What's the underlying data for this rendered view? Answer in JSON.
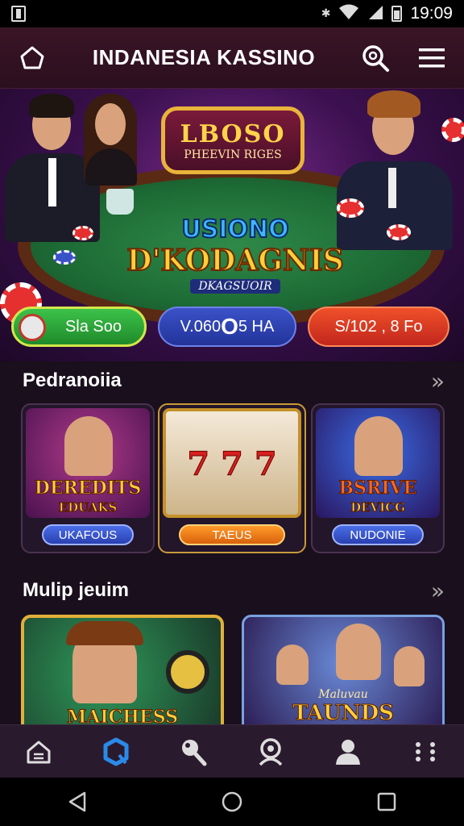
{
  "status_bar": {
    "time": "19:09"
  },
  "app_bar": {
    "title": "INDANESIA KASSINO"
  },
  "hero": {
    "badge_title": "LBOSO",
    "badge_subtitle": "PHEEVIN RIGES",
    "logo_line1": "USIONO",
    "logo_line2": "D'KODAGNIS",
    "logo_line3": "DKAGSUOIR",
    "cta_left": "Sla Soo",
    "cta_middle": "V.060 ",
    "cta_middle_big": "O",
    "cta_middle_rest": " 5 HA",
    "cta_right": "S/102 , 8 Fo"
  },
  "sections": [
    {
      "title": "Pedranoiia",
      "more": "»",
      "cards": [
        {
          "art_title": "DEREDITS",
          "art_sub": "EDUAKS",
          "button": "UKAFOUS",
          "color": "#3b5bd6"
        },
        {
          "art_title": "7 7 7",
          "art_sub": "",
          "button": "TAEUS",
          "color": "#e67b16"
        },
        {
          "art_title": "BSRIVE",
          "art_sub": "DEVICG",
          "button": "NUDONIE",
          "color": "#3b5bd6"
        }
      ]
    },
    {
      "title": "Mulip jeuim",
      "more": "»",
      "cards": [
        {
          "art_title": "MAICHESS"
        },
        {
          "art_title": "TAUNDS",
          "art_sub": "Maluvau"
        }
      ]
    }
  ],
  "bottom_nav": [
    "home",
    "casino",
    "search",
    "support",
    "profile",
    "more"
  ],
  "colors": {
    "accent_green": "#2faa3d",
    "accent_blue": "#2f46b8",
    "accent_red": "#e2352a",
    "gold": "#ffcf3a"
  }
}
